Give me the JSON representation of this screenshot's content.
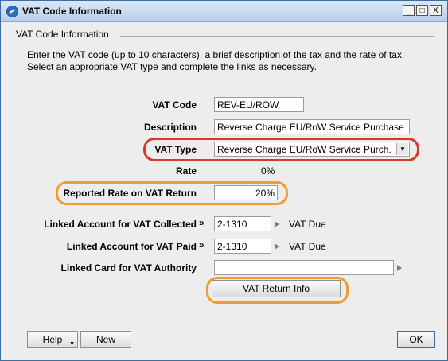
{
  "window": {
    "title": "VAT Code Information",
    "controls": {
      "minimize": "_",
      "maximize": "□",
      "close": "X"
    }
  },
  "section": {
    "title": "VAT Code Information",
    "description": "Enter the VAT code (up to 10 characters), a brief description of the tax and the rate of tax. Select an appropriate VAT type and complete the links as necessary."
  },
  "form": {
    "vat_code": {
      "label": "VAT Code",
      "value": "REV-EU/ROW"
    },
    "description": {
      "label": "Description",
      "value": "Reverse Charge EU/RoW Service Purchase"
    },
    "vat_type": {
      "label": "VAT Type",
      "value": "Reverse Charge EU/RoW Service Purch."
    },
    "rate": {
      "label": "Rate",
      "value": "0%"
    },
    "reported_rate": {
      "label": "Reported Rate on VAT Return",
      "value": "20%"
    },
    "linked_collected": {
      "label": "Linked Account for VAT Collected",
      "chevrons": "»",
      "value": "2-1310",
      "account_name": "VAT Due"
    },
    "linked_paid": {
      "label": "Linked Account for VAT Paid",
      "chevrons": "»",
      "value": "2-1310",
      "account_name": "VAT Due"
    },
    "linked_card": {
      "label": "Linked Card for VAT Authority",
      "value": ""
    },
    "vat_return_button": "VAT Return Info"
  },
  "footer": {
    "help": "Help",
    "new": "New",
    "ok": "OK"
  },
  "highlight_colors": {
    "red": "#d83a2a",
    "orange": "#f29a33"
  }
}
